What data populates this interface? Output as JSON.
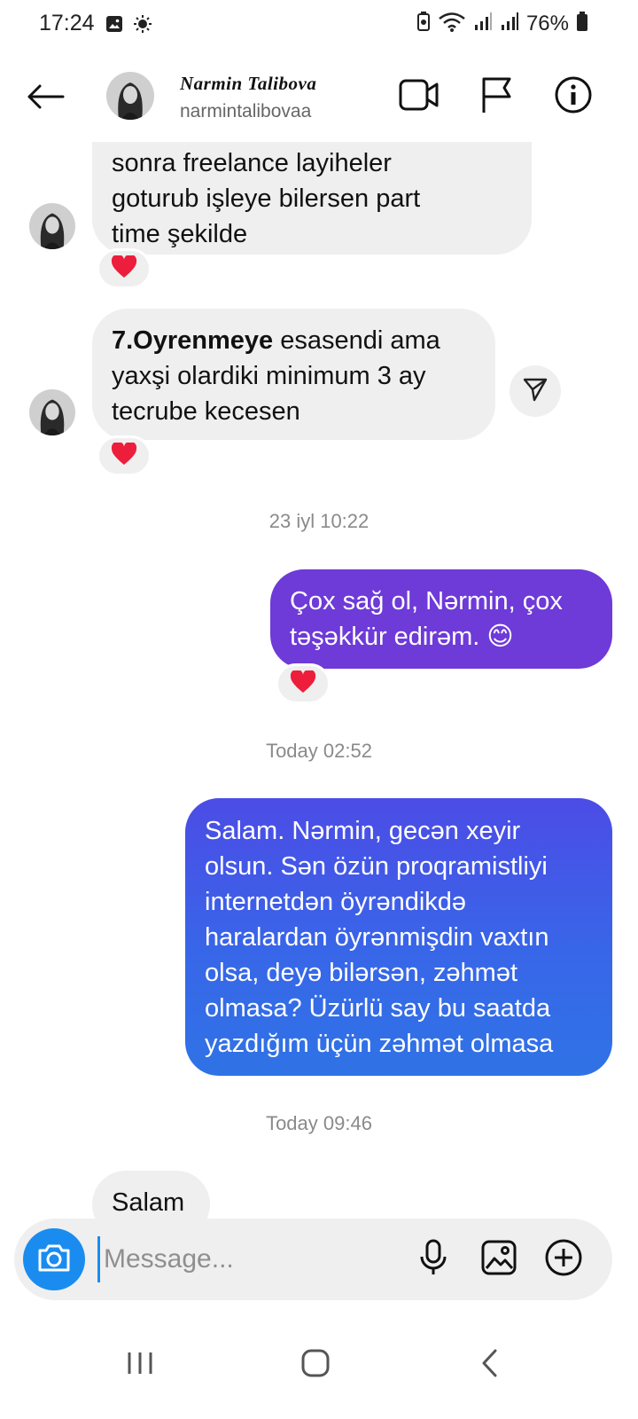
{
  "status_bar": {
    "time": "17:24",
    "battery": "76%"
  },
  "header": {
    "name": "Narmin Talibova",
    "username": "narmintalibovaa"
  },
  "messages": {
    "msg1": [
      "sonra freelance layiheler",
      "goturub işleye bilersen part",
      "time şekilde"
    ],
    "msg2_bold": "7.Oyrenmeye",
    "msg2_rest": " esasendi ama",
    "msg2_lines": [
      "yaxşi olardiki minimum 3 ay",
      "tecrube kecesen"
    ],
    "ts1": "23 iyl 10:22",
    "msg3": [
      "Çox sağ ol, Nərmin, çox",
      "təşəkkür edirəm. 😊"
    ],
    "ts2": "Today 02:52",
    "msg4": [
      "Salam. Nərmin, gecən xeyir",
      "olsun. Sən özün proqramistliyi",
      "internetdən öyrəndikdə",
      "haralardan öyrənmişdin vaxtın",
      "olsa, deyə bilərsən, zəhmət",
      "olmasa? Üzürlü say bu saatda",
      "yazdığım üçün zəhmət olmasa"
    ],
    "ts3": "Today 09:46",
    "msg5": "Salam",
    "reaction": "❤️"
  },
  "composer": {
    "placeholder": "Message..."
  },
  "colors": {
    "accent": "#1a8cf0",
    "outgoing_purple": "#6e3ad8",
    "outgoing_blue": "#3866e8",
    "incoming": "#efefef"
  },
  "icons": [
    "back-arrow-icon",
    "video-call-icon",
    "flag-icon",
    "info-icon",
    "share-icon",
    "camera-icon",
    "microphone-icon",
    "gallery-icon",
    "add-icon",
    "recents-icon",
    "home-icon",
    "nav-back-icon"
  ]
}
